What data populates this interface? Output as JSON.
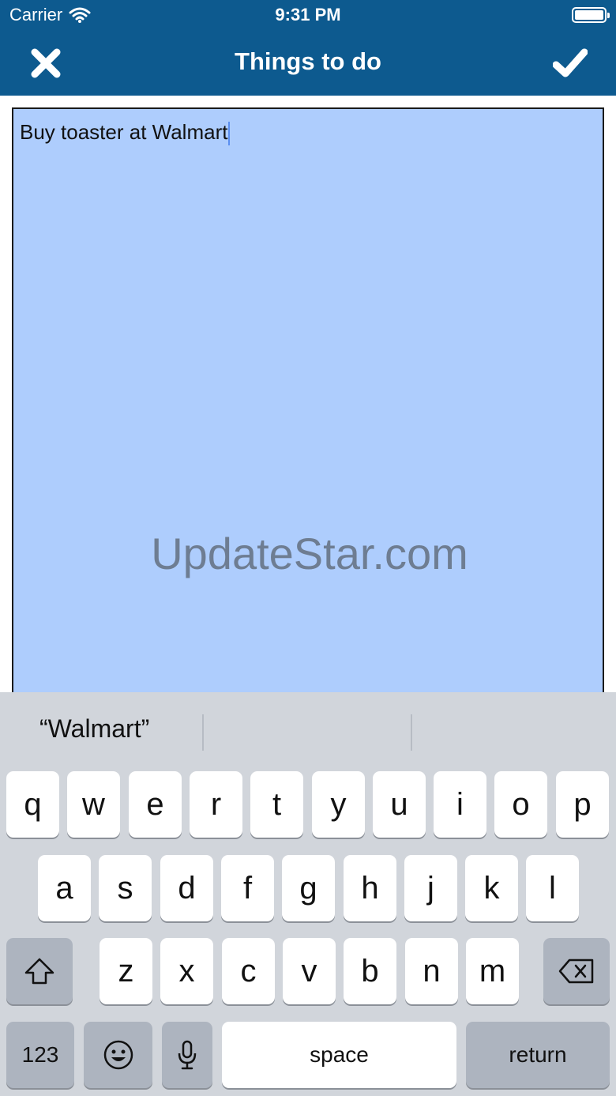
{
  "status_bar": {
    "carrier": "Carrier",
    "time": "9:31 PM"
  },
  "nav": {
    "title": "Things to do",
    "close_icon": "x-icon",
    "confirm_icon": "checkmark-icon",
    "color": "#0d5a8f"
  },
  "note": {
    "text": "Buy toaster at Walmart",
    "background": "#aecdfd",
    "watermark": "UpdateStar.com"
  },
  "keyboard": {
    "suggestion": "“Walmart”",
    "row1": [
      "q",
      "w",
      "e",
      "r",
      "t",
      "y",
      "u",
      "i",
      "o",
      "p"
    ],
    "row2": [
      "a",
      "s",
      "d",
      "f",
      "g",
      "h",
      "j",
      "k",
      "l"
    ],
    "row3": [
      "z",
      "x",
      "c",
      "v",
      "b",
      "n",
      "m"
    ],
    "numbers_label": "123",
    "space_label": "space",
    "return_label": "return"
  }
}
